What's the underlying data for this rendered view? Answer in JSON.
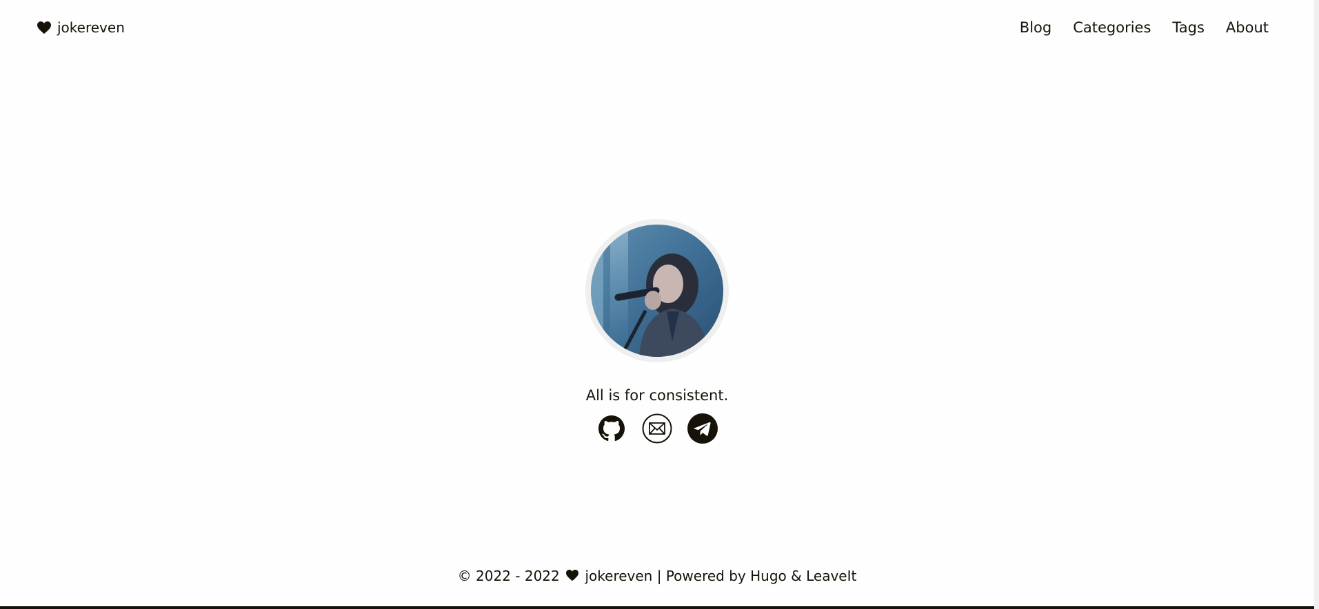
{
  "header": {
    "brand": {
      "icon": "heart-icon",
      "name": "jokereven"
    },
    "nav": [
      {
        "label": "Blog"
      },
      {
        "label": "Categories"
      },
      {
        "label": "Tags"
      },
      {
        "label": "About"
      }
    ]
  },
  "profile": {
    "avatar": "avatar-photo",
    "subtitle": "All is for consistent.",
    "social": [
      {
        "icon": "github-icon"
      },
      {
        "icon": "email-icon"
      },
      {
        "icon": "telegram-icon"
      }
    ]
  },
  "footer": {
    "copyright": "© 2022 - 2022",
    "heart_icon": "heart-icon",
    "author": "jokereven",
    "separator": "|",
    "powered_by": "Powered by",
    "hugo": "Hugo",
    "amp": "&",
    "theme": "LeaveIt"
  },
  "colors": {
    "text": "#161209",
    "background": "#fefefe",
    "avatar_ring": "#efefef"
  }
}
